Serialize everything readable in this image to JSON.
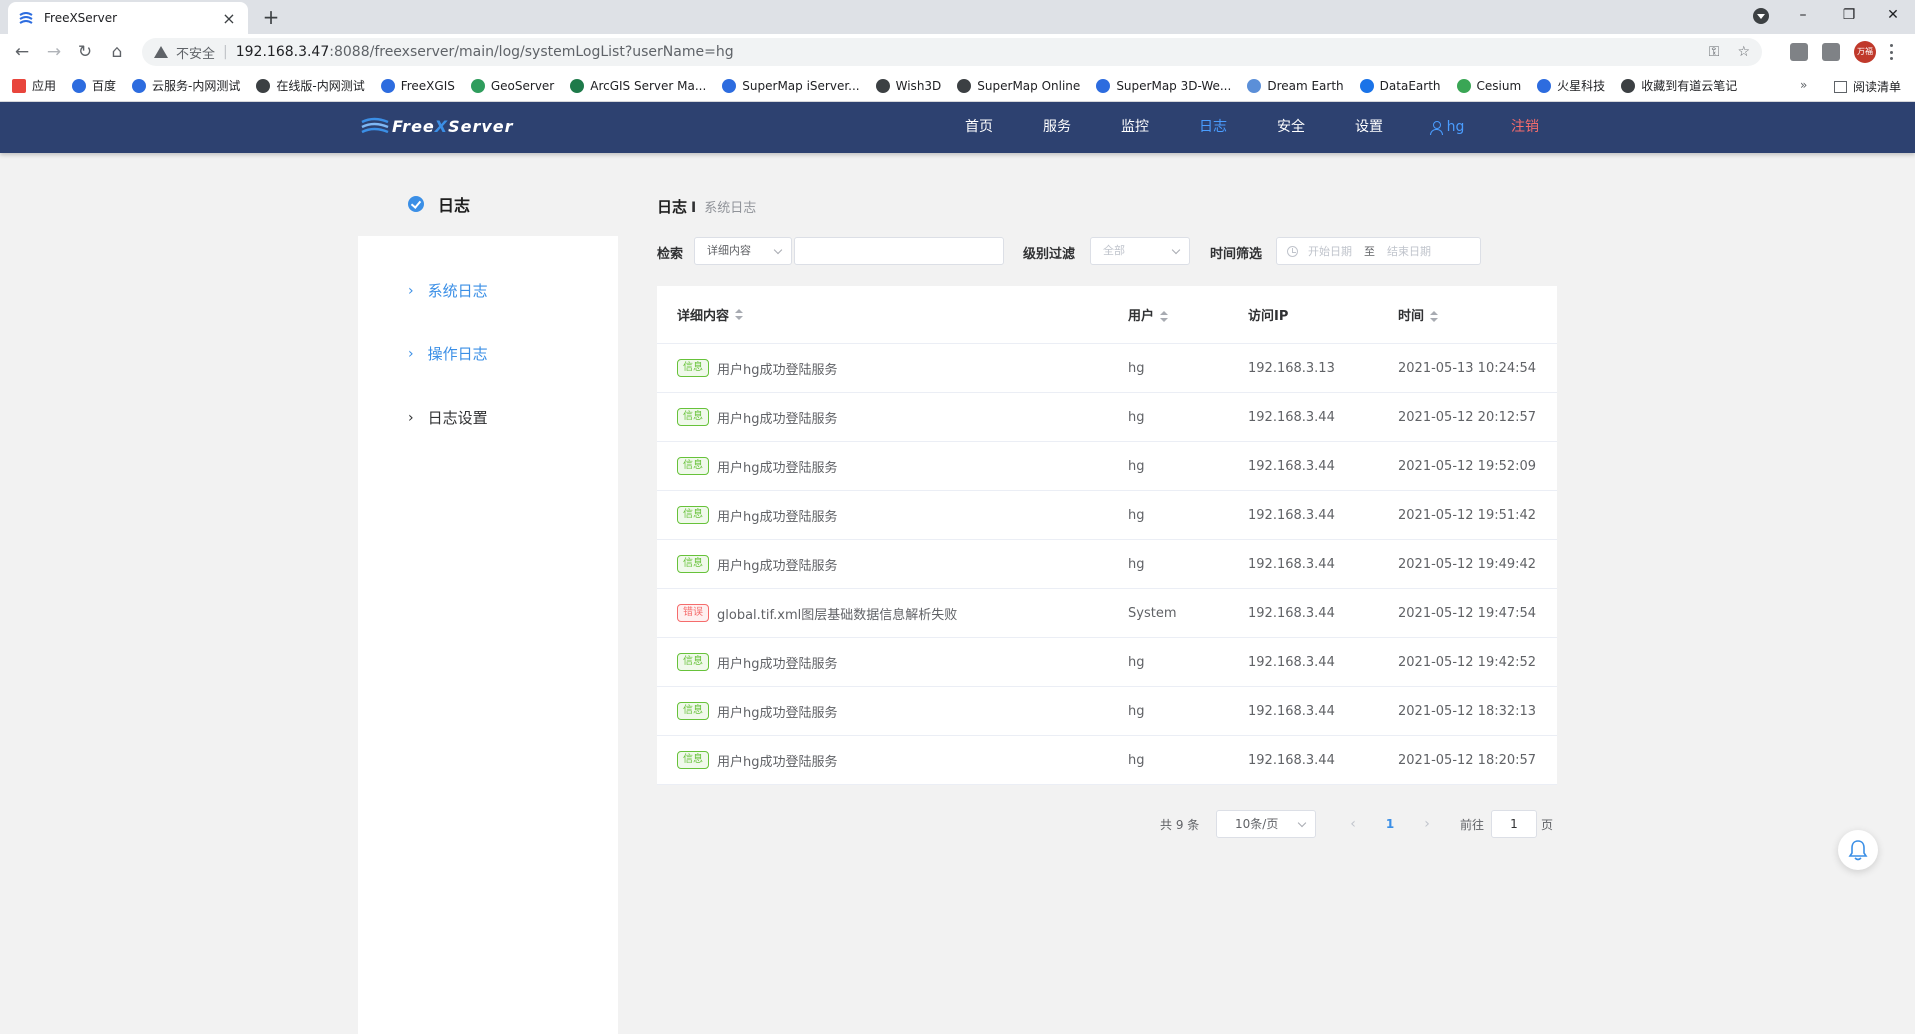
{
  "browser": {
    "tab_title": "FreeXServer",
    "security_label": "不安全",
    "url_host": "192.168.3.47",
    "url_path": ":8088/freexserver/main/log/systemLogList?userName=hg",
    "profile_label": "万福",
    "bookmarks": [
      "应用",
      "百度",
      "云服务-内网测试",
      "在线版-内网测试",
      "FreeXGIS",
      "GeoServer",
      "ArcGIS Server Ma...",
      "SuperMap iServer...",
      "Wish3D",
      "SuperMap Online",
      "SuperMap 3D-We...",
      "Dream Earth",
      "DataEarth",
      "Cesium",
      "火星科技",
      "收藏到有道云笔记"
    ],
    "bookmarks_more": "»",
    "reading_list": "阅读清单"
  },
  "header": {
    "logo_prefix": "Free",
    "logo_x": "X",
    "logo_suffix": "Server",
    "nav": [
      "首页",
      "服务",
      "监控",
      "日志",
      "安全",
      "设置"
    ],
    "active_nav": "日志",
    "user": "hg",
    "logout": "注销"
  },
  "sidebar": {
    "title": "日志",
    "items": [
      "系统日志",
      "操作日志",
      "日志设置"
    ]
  },
  "breadcrumb": {
    "main": "日志",
    "sep": "I",
    "sub": "系统日志"
  },
  "filters": {
    "search_label": "检索",
    "search_field": "详细内容",
    "level_label": "级别过滤",
    "level_value": "全部",
    "time_label": "时间筛选",
    "start_placeholder": "开始日期",
    "to": "至",
    "end_placeholder": "结束日期"
  },
  "table": {
    "headers": [
      "详细内容",
      "用户",
      "访问IP",
      "时间"
    ],
    "rows": [
      {
        "tag": "信息",
        "level": "info",
        "content": "用户hg成功登陆服务",
        "user": "hg",
        "ip": "192.168.3.13",
        "time": "2021-05-13 10:24:54"
      },
      {
        "tag": "信息",
        "level": "info",
        "content": "用户hg成功登陆服务",
        "user": "hg",
        "ip": "192.168.3.44",
        "time": "2021-05-12 20:12:57"
      },
      {
        "tag": "信息",
        "level": "info",
        "content": "用户hg成功登陆服务",
        "user": "hg",
        "ip": "192.168.3.44",
        "time": "2021-05-12 19:52:09"
      },
      {
        "tag": "信息",
        "level": "info",
        "content": "用户hg成功登陆服务",
        "user": "hg",
        "ip": "192.168.3.44",
        "time": "2021-05-12 19:51:42"
      },
      {
        "tag": "信息",
        "level": "info",
        "content": "用户hg成功登陆服务",
        "user": "hg",
        "ip": "192.168.3.44",
        "time": "2021-05-12 19:49:42"
      },
      {
        "tag": "错误",
        "level": "error",
        "content": "global.tif.xml图层基础数据信息解析失败",
        "user": "System",
        "ip": "192.168.3.44",
        "time": "2021-05-12 19:47:54"
      },
      {
        "tag": "信息",
        "level": "info",
        "content": "用户hg成功登陆服务",
        "user": "hg",
        "ip": "192.168.3.44",
        "time": "2021-05-12 19:42:52"
      },
      {
        "tag": "信息",
        "level": "info",
        "content": "用户hg成功登陆服务",
        "user": "hg",
        "ip": "192.168.3.44",
        "time": "2021-05-12 18:32:13"
      },
      {
        "tag": "信息",
        "level": "info",
        "content": "用户hg成功登陆服务",
        "user": "hg",
        "ip": "192.168.3.44",
        "time": "2021-05-12 18:20:57"
      }
    ]
  },
  "pagination": {
    "total": "共 9 条",
    "page_size": "10条/页",
    "current_page": "1",
    "goto_label": "前往",
    "goto_value": "1",
    "page_label": "页"
  },
  "colors": {
    "header_bg": "#2d4170",
    "accent": "#3b8fe6",
    "info": "#67c23a",
    "error": "#f56c6c"
  }
}
